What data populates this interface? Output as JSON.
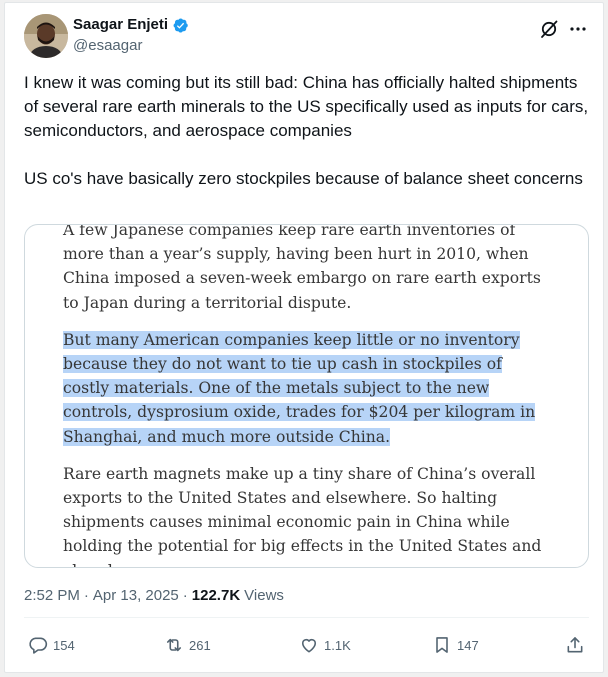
{
  "author": {
    "name": "Saagar Enjeti",
    "handle": "@esaagar",
    "verified": true,
    "verified_color": "#1d9bf0"
  },
  "tweet": {
    "text": "I knew it was coming but its still bad: China has officially halted shipments of several rare earth minerals to the US specifically used as inputs for cars, semiconductors, and aerospace companies\n\nUS co's have basically zero stockpiles because of balance sheet concerns"
  },
  "quote_image": {
    "paragraphs": [
      "A few Japanese companies keep rare earth inventories of more than a year’s supply, having been hurt in 2010, when China imposed a seven-week embargo on rare earth exports to Japan during a territorial dispute.",
      "But many American companies keep little or no inventory because they do not want to tie up cash in stockpiles of costly materials. One of the metals subject to the new controls, dysprosium oxide, trades for $204 per kilogram in Shanghai, and much more outside China.",
      "Rare earth magnets make up a tiny share of China’s overall exports to the United States and elsewhere. So halting shipments causes minimal economic pain in China while holding the potential for big effects in the United States and elsewhere."
    ],
    "highlight_color": "#b7d4f7"
  },
  "meta": {
    "time": "2:52 PM",
    "separator": "·",
    "date": "Apr 13, 2025",
    "views_count": "122.7K",
    "views_label": "Views"
  },
  "actions": {
    "replies": "154",
    "reposts": "261",
    "likes": "1.1K",
    "bookmarks": "147"
  },
  "icons": {
    "header": [
      "grok-icon",
      "more-icon"
    ],
    "actions": [
      "reply-icon",
      "repost-icon",
      "like-icon",
      "bookmark-icon",
      "share-icon"
    ]
  }
}
